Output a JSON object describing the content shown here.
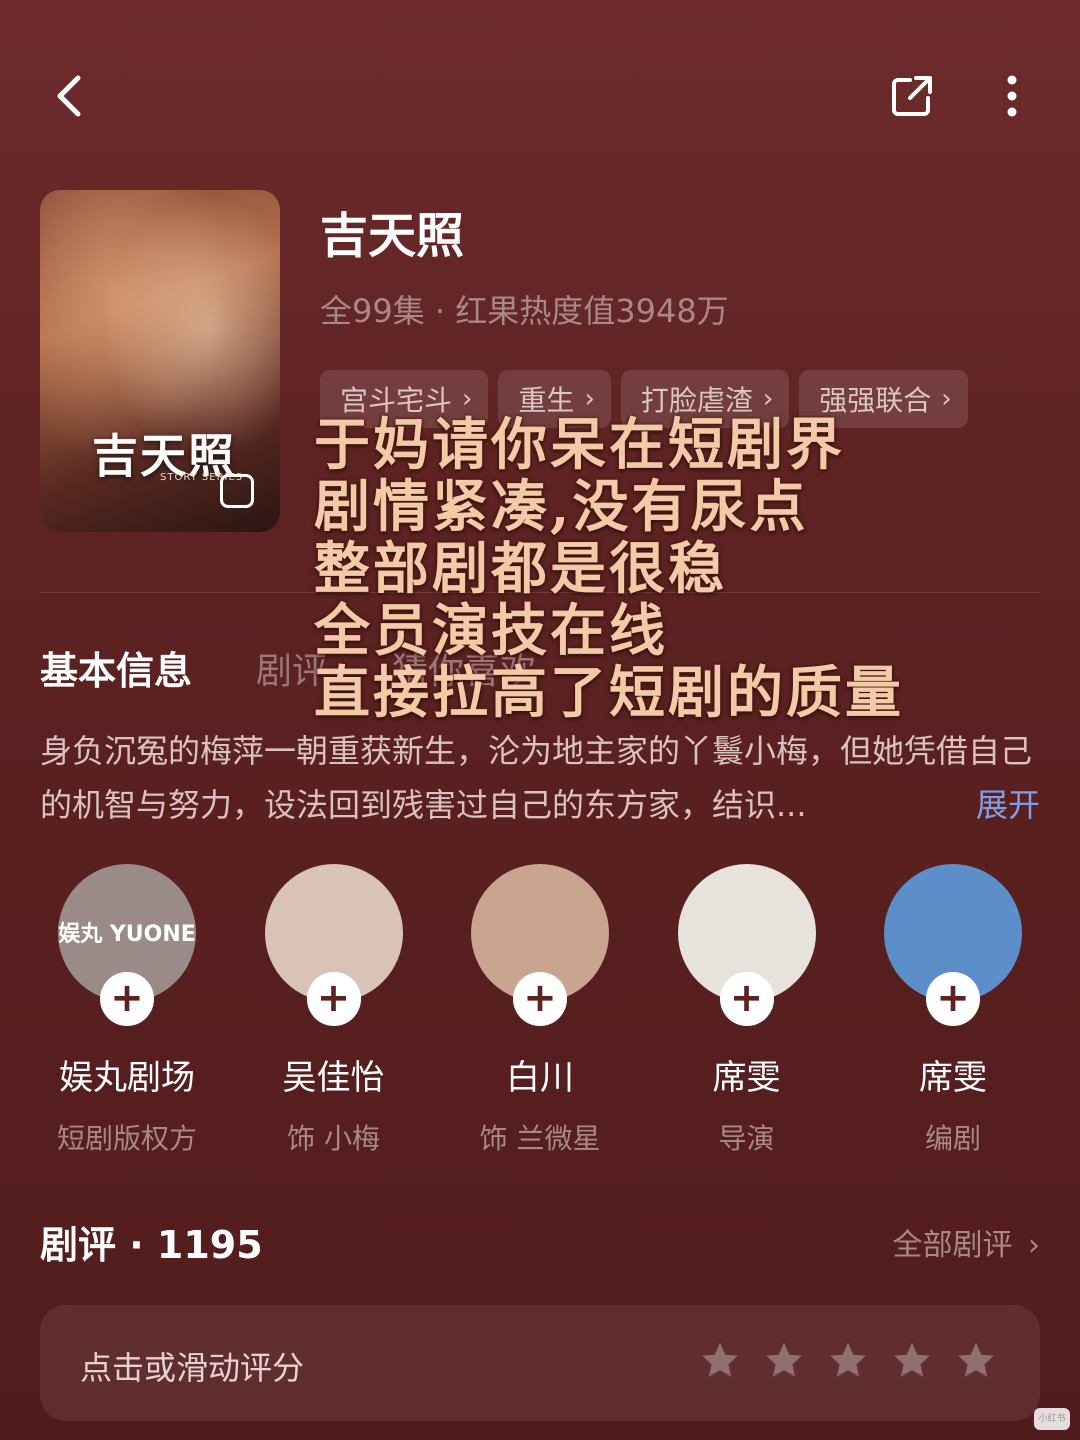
{
  "header": {
    "back_icon": "chevron-left-icon",
    "share_icon": "share-icon",
    "more_icon": "more-vertical-icon"
  },
  "drama": {
    "poster_text": "吉天照",
    "poster_subtext": "STORY SERIES",
    "title": "吉天照",
    "meta": "全99集 · 红果热度值3948万",
    "tags": [
      "宫斗宅斗",
      "重生",
      "打脸虐渣",
      "强强联合"
    ]
  },
  "overlay_lines": [
    "于妈请你呆在短剧界",
    "剧情紧凑,没有尿点",
    "整部剧都是很稳",
    "全员演技在线",
    "直接拉高了短剧的质量"
  ],
  "tabs": {
    "active": "基本信息",
    "items": [
      "剧评",
      "猜你喜欢"
    ]
  },
  "synopsis": {
    "text": "身负沉冤的梅萍一朝重获新生，沦为地主家的丫鬟小梅，但她凭借自己的机智与努力，设法回到残害过自己的东方家，结识...",
    "expand": "展开"
  },
  "cast": [
    {
      "name": "娱丸剧场",
      "role": "短剧版权方",
      "avatar_text": "娱丸 YUONE",
      "color": "#9a8a88"
    },
    {
      "name": "吴佳怡",
      "role": "饰 小梅",
      "avatar_text": "",
      "color": "#d8c3b6"
    },
    {
      "name": "白川",
      "role": "饰 兰微星",
      "avatar_text": "",
      "color": "#c9a48e"
    },
    {
      "name": "席雯",
      "role": "导演",
      "avatar_text": "",
      "color": "#e8e2dc"
    },
    {
      "name": "席雯",
      "role": "编剧",
      "avatar_text": "",
      "color": "#5c8fc9"
    }
  ],
  "reviews": {
    "title": "剧评 · 1195",
    "all_link": "全部剧评",
    "rate_prompt": "点击或滑动评分",
    "stars": 5,
    "star_color": "#8f6f6f"
  },
  "watermark": "小红书"
}
